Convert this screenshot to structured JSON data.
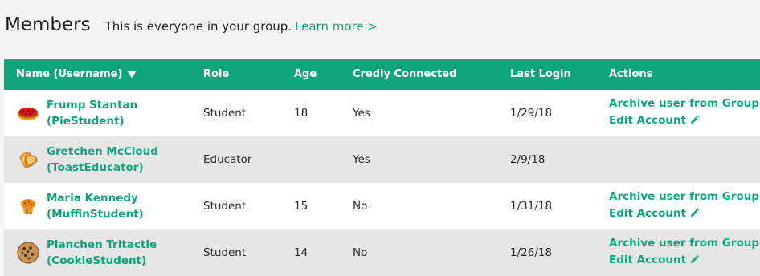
{
  "header": {
    "title": "Members",
    "subtitle": "This is everyone in your group.",
    "learn_more": "Learn more >"
  },
  "table": {
    "columns": {
      "name": "Name (Username)",
      "role": "Role",
      "age": "Age",
      "credly": "Credly Connected",
      "last_login": "Last Login",
      "actions": "Actions"
    },
    "rows": [
      {
        "avatar": "pie-icon",
        "name": "Frump Stantan",
        "username": "(PieStudent)",
        "role": "Student",
        "age": "18",
        "credly": "Yes",
        "last_login": "1/29/18",
        "archive_label": "Archive user from Group",
        "edit_label": "Edit Account"
      },
      {
        "avatar": "toast-icon",
        "name": "Gretchen McCloud",
        "username": "(ToastEducator)",
        "role": "Educator",
        "age": "",
        "credly": "Yes",
        "last_login": "2/9/18",
        "archive_label": "",
        "edit_label": ""
      },
      {
        "avatar": "muffin-icon",
        "name": "Maria Kennedy",
        "username": "(MuffinStudent)",
        "role": "Student",
        "age": "15",
        "credly": "No",
        "last_login": "1/31/18",
        "archive_label": "Archive user from Group",
        "edit_label": "Edit Account"
      },
      {
        "avatar": "cookie-icon",
        "name": "Planchen Tritactle",
        "username": "(CookieStudent)",
        "role": "Student",
        "age": "14",
        "credly": "No",
        "last_login": "1/26/18",
        "archive_label": "Archive user from Group",
        "edit_label": "Edit Account"
      }
    ]
  },
  "colors": {
    "accent": "#0fa57a",
    "row_alt": "#e6e6e6"
  }
}
